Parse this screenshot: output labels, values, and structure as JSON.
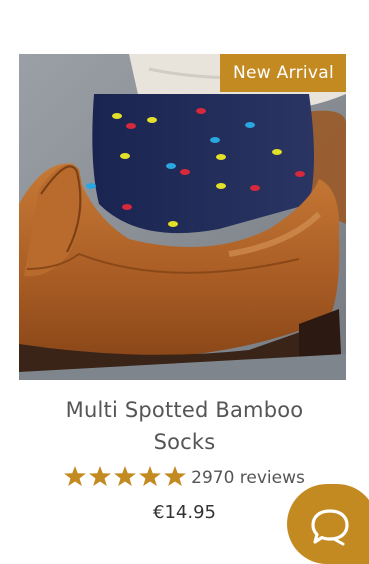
{
  "product": {
    "badge": "New Arrival",
    "title_line1": "Multi Spotted Bamboo",
    "title_line2": "Socks",
    "rating": 5,
    "rating_max": 5,
    "reviews_text": "2970 reviews",
    "price": "€14.95",
    "image_icon": "sock-on-loafer-photo"
  },
  "chat": {
    "icon": "chat-bubble-icon"
  },
  "colors": {
    "accent": "#c48a22",
    "sock_navy": "#1f2b55",
    "dot_yellow": "#e3e02a",
    "dot_red": "#d8283c",
    "dot_blue": "#2aa6e0",
    "shoe_tan": "#b0642a"
  }
}
